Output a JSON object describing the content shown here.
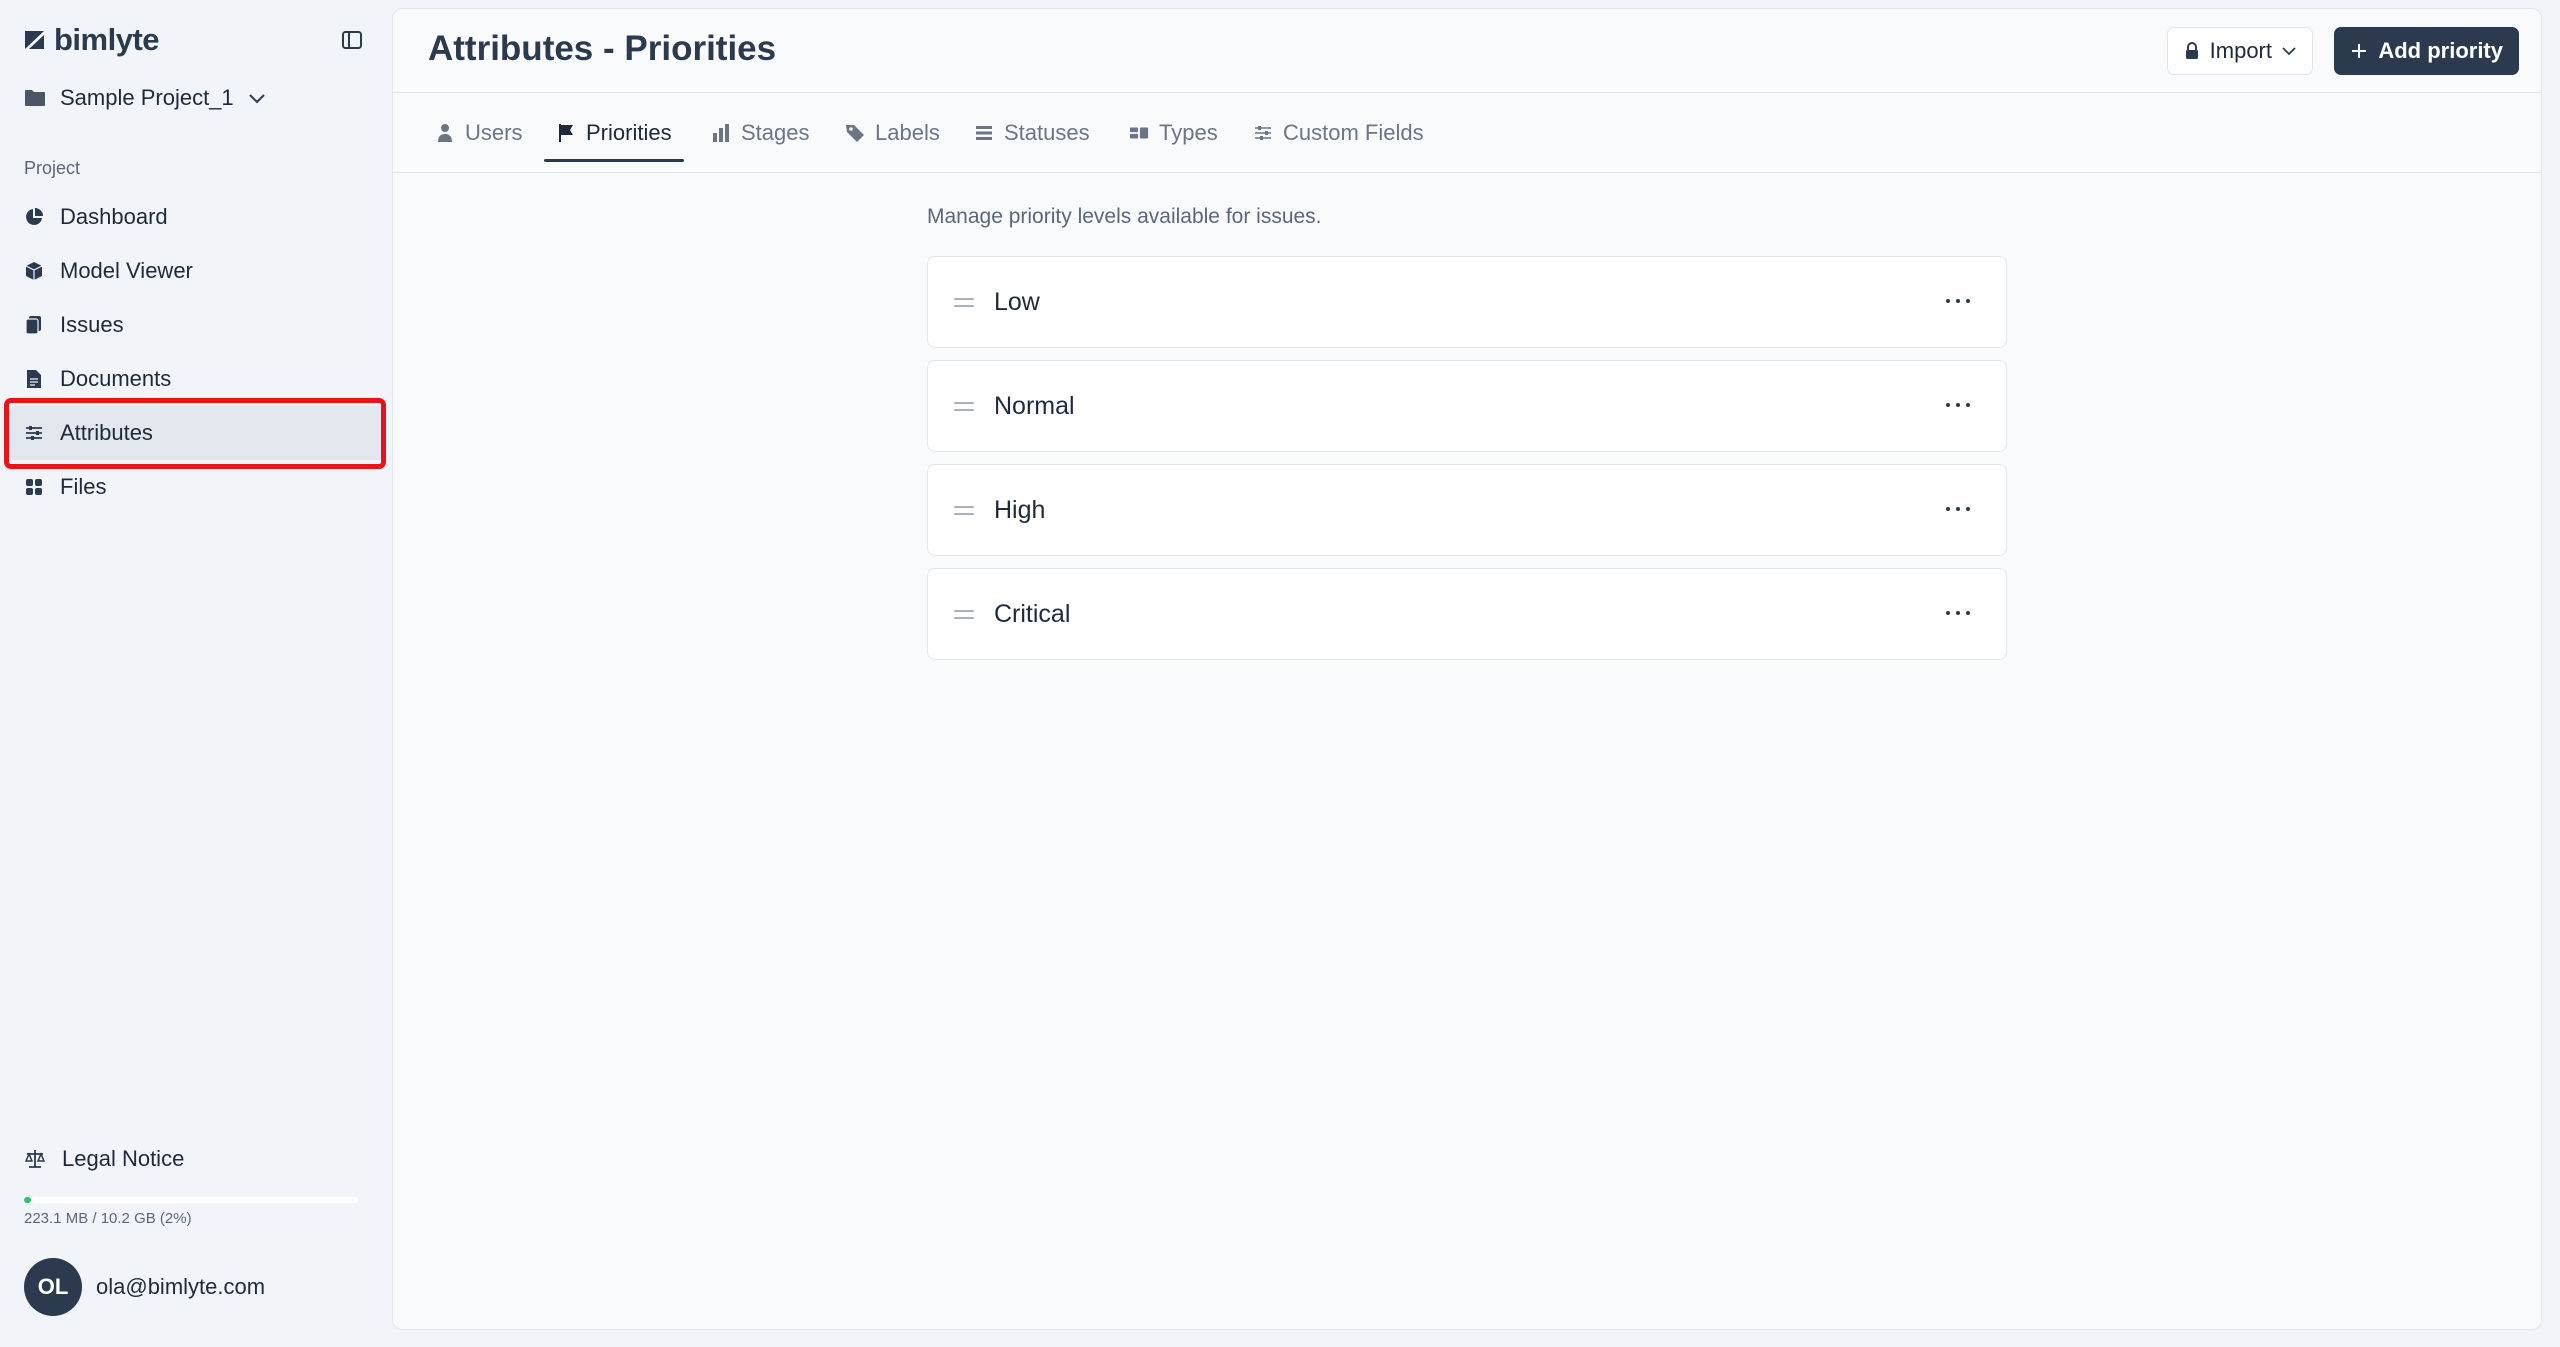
{
  "app": {
    "logo_text": "bimlyte"
  },
  "sidebar": {
    "project_name": "Sample Project_1",
    "section_label": "Project",
    "items": [
      {
        "label": "Dashboard",
        "icon": "pie-chart-icon",
        "active": false
      },
      {
        "label": "Model Viewer",
        "icon": "cube-icon",
        "active": false
      },
      {
        "label": "Issues",
        "icon": "clipboard-icon",
        "active": false
      },
      {
        "label": "Documents",
        "icon": "document-icon",
        "active": false
      },
      {
        "label": "Attributes",
        "icon": "sliders-icon",
        "active": true
      },
      {
        "label": "Files",
        "icon": "grid-icon",
        "active": false
      }
    ],
    "legal_notice": "Legal Notice",
    "storage_text": "223.1 MB / 10.2 GB (2%)",
    "storage_fraction": 0.02,
    "user": {
      "initials": "OL",
      "email": "ola@bimlyte.com"
    }
  },
  "header": {
    "title": "Attributes - Priorities",
    "import_label": "Import",
    "add_label": "Add priority"
  },
  "tabs": [
    {
      "label": "Users",
      "icon": "user-icon",
      "active": false
    },
    {
      "label": "Priorities",
      "icon": "flag-icon",
      "active": true
    },
    {
      "label": "Stages",
      "icon": "bar-chart-icon",
      "active": false
    },
    {
      "label": "Labels",
      "icon": "tag-icon",
      "active": false
    },
    {
      "label": "Statuses",
      "icon": "list-icon",
      "active": false
    },
    {
      "label": "Types",
      "icon": "types-icon",
      "active": false
    },
    {
      "label": "Custom Fields",
      "icon": "sliders-icon",
      "active": false
    }
  ],
  "content": {
    "description": "Manage priority levels available for issues.",
    "priorities": [
      "Low",
      "Normal",
      "High",
      "Critical"
    ]
  },
  "colors": {
    "brand_dark": "#2b3a4e",
    "annotation_red": "#e8141a",
    "storage_green": "#22c55e"
  }
}
